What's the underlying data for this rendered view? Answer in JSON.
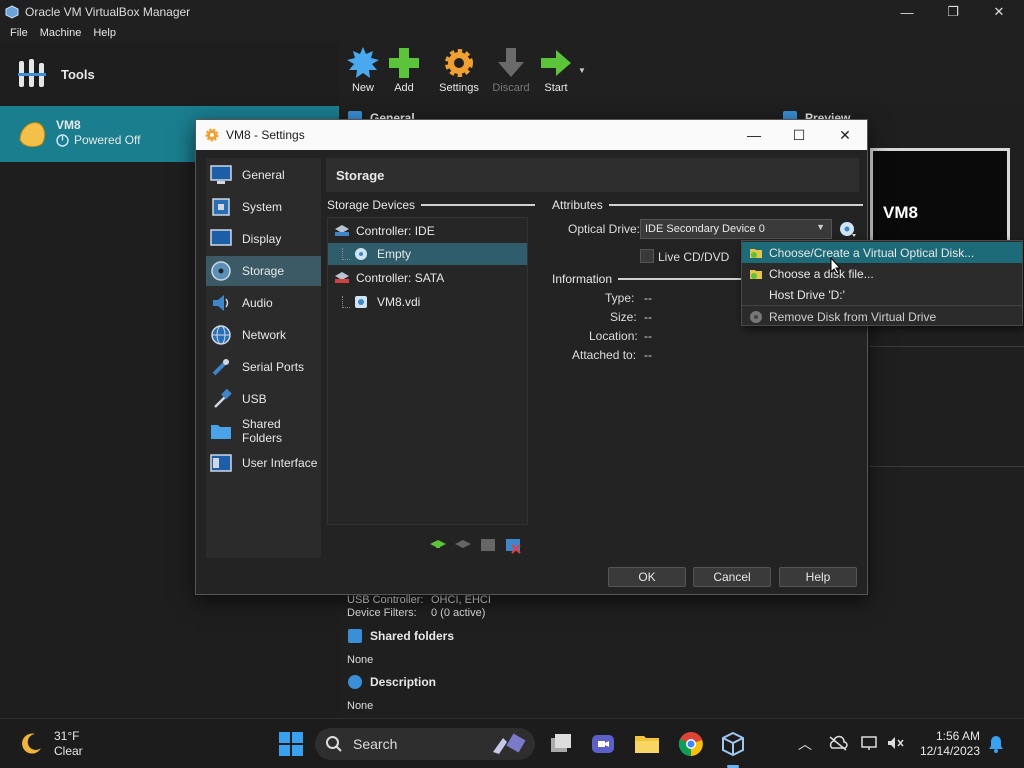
{
  "window": {
    "title": "Oracle VM VirtualBox Manager",
    "menu": [
      "File",
      "Machine",
      "Help"
    ]
  },
  "left_pane": {
    "tools_label": "Tools",
    "vm": {
      "name": "VM8",
      "state": "Powered Off"
    }
  },
  "toolbar": {
    "new": "New",
    "add": "Add",
    "settings": "Settings",
    "discard": "Discard",
    "start": "Start"
  },
  "details": {
    "general": "General",
    "preview": "Preview",
    "preview_vm": "VM8",
    "usb_controller_label": "USB Controller:",
    "usb_controller_value": "OHCI, EHCI",
    "device_filters_label": "Device Filters:",
    "device_filters_value": "0 (0 active)",
    "shared_folders": "Shared folders",
    "shared_folders_value": "None",
    "description": "Description",
    "description_value": "None"
  },
  "dialog": {
    "title": "VM8 - Settings",
    "categories": [
      "General",
      "System",
      "Display",
      "Storage",
      "Audio",
      "Network",
      "Serial Ports",
      "USB",
      "Shared Folders",
      "User Interface"
    ],
    "selected_category": "Storage",
    "page_title": "Storage",
    "storage_devices_label": "Storage Devices",
    "tree": {
      "controller_ide": "Controller: IDE",
      "empty": "Empty",
      "controller_sata": "Controller: SATA",
      "vdi": "VM8.vdi"
    },
    "attributes_label": "Attributes",
    "optical_drive_label": "Optical Drive:",
    "optical_drive_value": "IDE Secondary Device 0",
    "live_cd_label": "Live CD/DVD",
    "information_label": "Information",
    "info": {
      "type_label": "Type:",
      "type_value": "--",
      "size_label": "Size:",
      "size_value": "--",
      "location_label": "Location:",
      "location_value": "--",
      "attached_label": "Attached to:",
      "attached_value": "--"
    },
    "buttons": {
      "ok": "OK",
      "cancel": "Cancel",
      "help": "Help"
    }
  },
  "dropdown": {
    "items": [
      "Choose/Create a Virtual Optical Disk...",
      "Choose a disk file...",
      "Host Drive 'D:'",
      "Remove Disk from Virtual Drive"
    ]
  },
  "taskbar": {
    "temp": "31°F",
    "weather": "Clear",
    "search": "Search",
    "time": "1:56 AM",
    "date": "12/14/2023"
  }
}
